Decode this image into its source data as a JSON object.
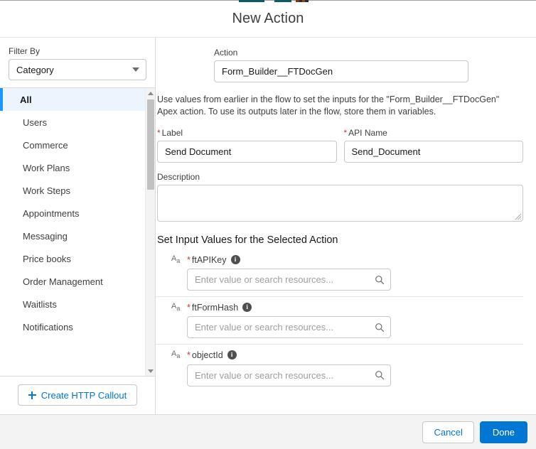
{
  "header": {
    "title": "New Action"
  },
  "sidebar": {
    "filter": {
      "label": "Filter By",
      "selected": "Category",
      "caret_icon": "chevron-down-icon"
    },
    "categories": [
      {
        "label": "All",
        "selected": true
      },
      {
        "label": "Users",
        "selected": false
      },
      {
        "label": "Commerce",
        "selected": false
      },
      {
        "label": "Work Plans",
        "selected": false
      },
      {
        "label": "Work Steps",
        "selected": false
      },
      {
        "label": "Appointments",
        "selected": false
      },
      {
        "label": "Messaging",
        "selected": false
      },
      {
        "label": "Price books",
        "selected": false
      },
      {
        "label": "Order Management",
        "selected": false
      },
      {
        "label": "Waitlists",
        "selected": false
      },
      {
        "label": "Notifications",
        "selected": false
      }
    ],
    "scrollbar": {
      "up_icon": "scroll-up-arrow-icon",
      "down_icon": "scroll-down-arrow-icon"
    },
    "footer_button": {
      "label": "Create HTTP Callout",
      "icon": "plus-icon"
    }
  },
  "main": {
    "action_field": {
      "label": "Action",
      "value": "Form_Builder__FTDocGen"
    },
    "helper_text": "Use values from earlier in the flow to set the inputs for the \"Form_Builder__FTDocGen\" Apex action. To use its outputs later in the flow, store them in variables.",
    "label_field": {
      "label": "Label",
      "required": "*",
      "value": "Send Document"
    },
    "api_name_field": {
      "label": "API Name",
      "required": "*",
      "value": "Send_Document"
    },
    "description_field": {
      "label": "Description",
      "value": "",
      "placeholder": ""
    },
    "inputs_section": {
      "heading": "Set Input Values for the Selected Action",
      "rows": [
        {
          "type_icon": "text-type-icon",
          "type_label_a": "A",
          "type_label_sub": "a",
          "required": "*",
          "name": "ftAPIKey",
          "info_icon": "info-icon",
          "value": "",
          "placeholder": "Enter value or search resources...",
          "search_icon": "search-icon"
        },
        {
          "type_icon": "text-type-icon",
          "type_label_a": "A",
          "type_label_sub": "a",
          "required": "*",
          "name": "ftFormHash",
          "info_icon": "info-icon",
          "value": "",
          "placeholder": "Enter value or search resources...",
          "search_icon": "search-icon"
        },
        {
          "type_icon": "text-type-icon",
          "type_label_a": "A",
          "type_label_sub": "a",
          "required": "*",
          "name": "objectId",
          "info_icon": "info-icon",
          "value": "",
          "placeholder": "Enter value or search resources...",
          "search_icon": "search-icon"
        }
      ]
    }
  },
  "footer": {
    "cancel_label": "Cancel",
    "done_label": "Done"
  },
  "colors": {
    "brand_blue": "#0176d3",
    "selected_item_bg": "#ecf5fd",
    "selected_item_border": "#1b96ff",
    "required_red": "#c23934",
    "footer_bg": "#f3f3f3",
    "border_gray": "#c9c7c5",
    "text_dark": "#181818",
    "text_muted": "#3e3e3c"
  }
}
